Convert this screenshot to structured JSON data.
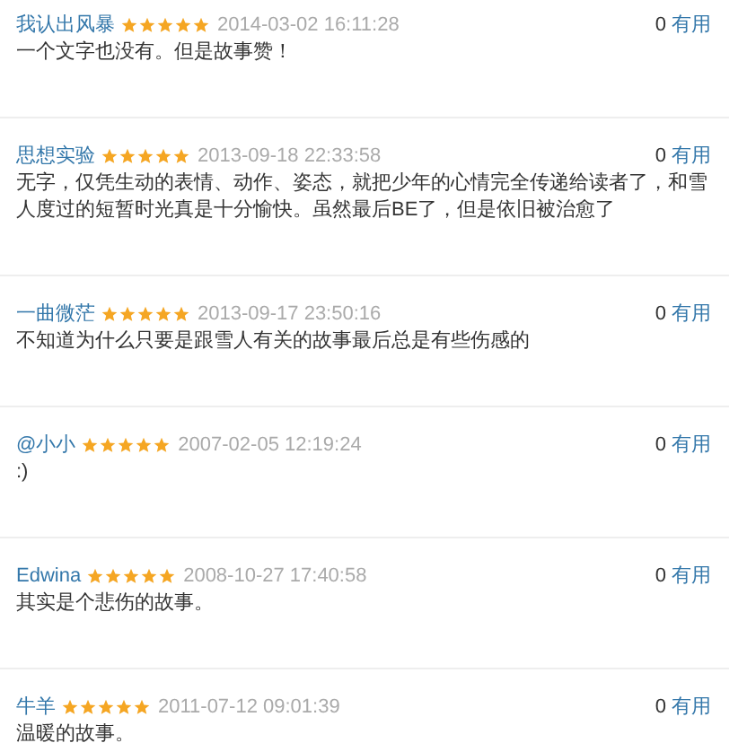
{
  "reviews": [
    {
      "user": "我认出风暴",
      "stars": 5,
      "time": "2014-03-02 16:11:28",
      "votes": "0",
      "vote_label": "有用",
      "comment": "一个文字也没有。但是故事赞！"
    },
    {
      "user": "思想实验",
      "stars": 5,
      "time": "2013-09-18 22:33:58",
      "votes": "0",
      "vote_label": "有用",
      "comment": "无字，仅凭生动的表情、动作、姿态，就把少年的心情完全传递给读者了，和雪人度过的短暂时光真是十分愉快。虽然最后BE了，但是依旧被治愈了"
    },
    {
      "user": "一曲微茫",
      "stars": 5,
      "time": "2013-09-17 23:50:16",
      "votes": "0",
      "vote_label": "有用",
      "comment": "不知道为什么只要是跟雪人有关的故事最后总是有些伤感的"
    },
    {
      "user": "@小小",
      "stars": 5,
      "time": "2007-02-05 12:19:24",
      "votes": "0",
      "vote_label": "有用",
      "comment": ":)"
    },
    {
      "user": "Edwina",
      "stars": 5,
      "time": "2008-10-27 17:40:58",
      "votes": "0",
      "vote_label": "有用",
      "comment": "其实是个悲伤的故事。"
    },
    {
      "user": "牛羊",
      "stars": 5,
      "time": "2011-07-12 09:01:39",
      "votes": "0",
      "vote_label": "有用",
      "comment": "温暖的故事。"
    }
  ]
}
